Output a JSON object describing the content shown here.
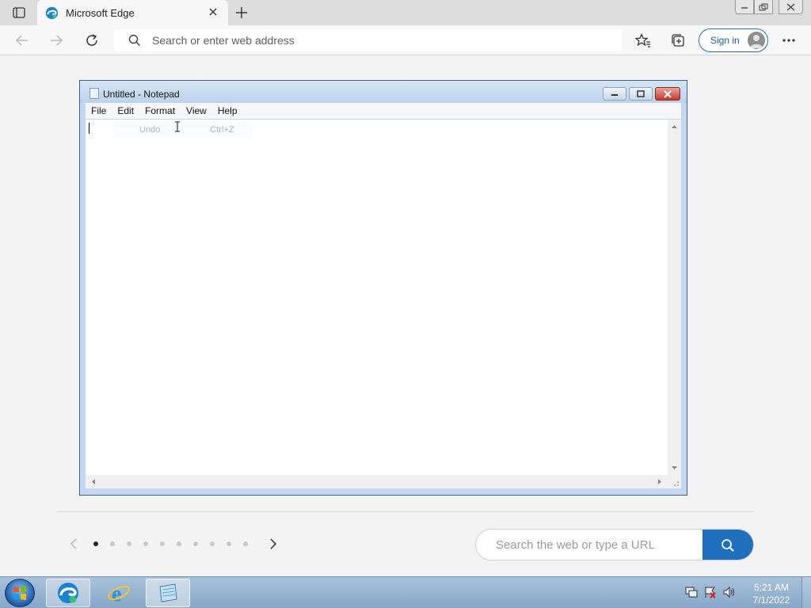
{
  "browser": {
    "tab_title": "Microsoft Edge",
    "address_placeholder": "Search or enter web address",
    "signin_label": "Sign in"
  },
  "notepad": {
    "title": "Untitled - Notepad",
    "menu": [
      "File",
      "Edit",
      "Format",
      "View",
      "Help"
    ],
    "ghost_menu_item": {
      "label": "Undo",
      "shortcut": "Ctrl+Z"
    }
  },
  "newtab": {
    "carousel_dot_count": 10,
    "carousel_active_index": 0,
    "search_placeholder": "Search the web or type a URL"
  },
  "taskbar": {
    "time": "5:21 AM",
    "date": "7/1/2022",
    "pinned": [
      "edge-icon",
      "internet-explorer-icon",
      "notepad-icon"
    ]
  },
  "colors": {
    "accent_blue": "#1f6fbf",
    "taskbar": "#86a6c8",
    "notepad_frame": "#c3d8ef"
  }
}
